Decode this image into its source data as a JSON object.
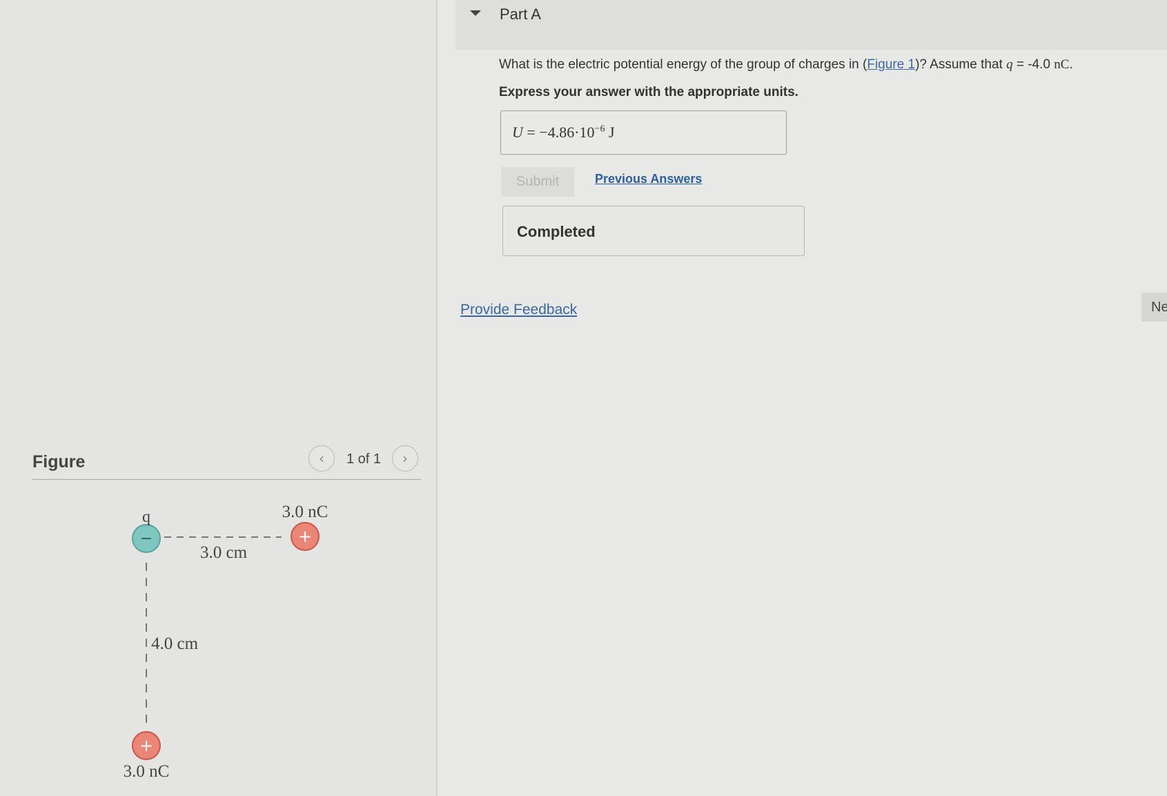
{
  "part": {
    "title": "Part A"
  },
  "question": {
    "text_before": "What is the electric potential energy of the group of charges in (",
    "figure_link": "Figure 1",
    "text_middle": ")? Assume that ",
    "var": "q",
    "value": " = -4.0 ",
    "unit": "nC",
    "end": "."
  },
  "instruction": "Express your answer with the appropriate units.",
  "answer": {
    "lhs": "U",
    "eq": " = ",
    "mantissa": "−4.86·10",
    "exponent": "−6",
    "unit": " J"
  },
  "buttons": {
    "submit": "Submit",
    "previous_answers": "Previous Answers",
    "next": "Ne"
  },
  "status": "Completed",
  "feedback": "Provide Feedback",
  "figure": {
    "label": "Figure",
    "pager": "1 of 1",
    "prev_glyph": "‹",
    "next_glyph": "›",
    "charge_q_label": "q",
    "charge_q_sign": "−",
    "charge_right_label": "3.0 nC",
    "charge_right_sign": "+",
    "charge_bottom_label": "3.0 nC",
    "charge_bottom_sign": "+",
    "horizontal_distance": "3.0 cm",
    "vertical_distance": "4.0 cm",
    "colors": {
      "negative": "#7fc6c0",
      "positive": "#e98678",
      "dash": "#555555"
    }
  }
}
